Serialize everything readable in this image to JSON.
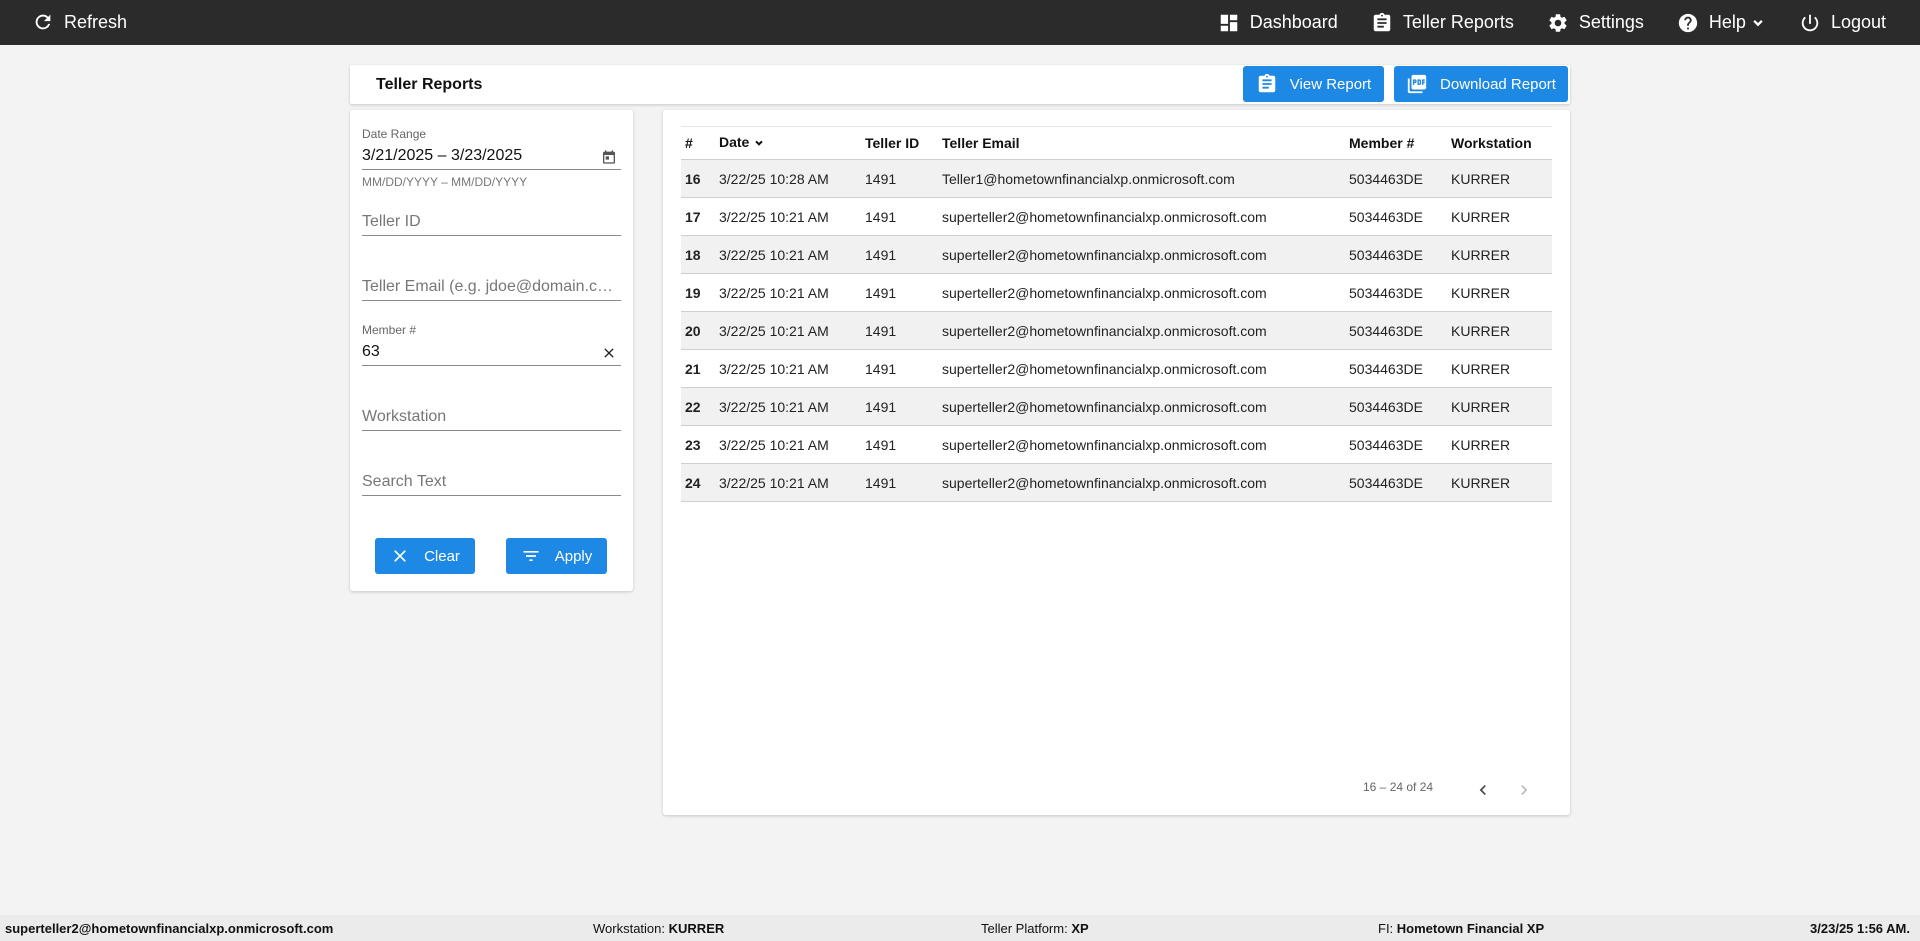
{
  "topbar": {
    "refresh_label": "Refresh",
    "nav": [
      {
        "label": "Dashboard",
        "icon": "dashboard-icon"
      },
      {
        "label": "Teller Reports",
        "icon": "clipboard-icon"
      },
      {
        "label": "Settings",
        "icon": "gear-icon"
      },
      {
        "label": "Help",
        "icon": "help-icon"
      },
      {
        "label": "Logout",
        "icon": "power-icon"
      }
    ]
  },
  "header": {
    "title": "Teller Reports",
    "view_report_label": "View Report",
    "download_report_label": "Download Report"
  },
  "filters": {
    "date_range_label": "Date Range",
    "date_range_value": "3/21/2025 – 3/23/2025",
    "date_range_hint": "MM/DD/YYYY – MM/DD/YYYY",
    "teller_id_placeholder": "Teller ID",
    "teller_email_placeholder": "Teller Email (e.g. jdoe@domain.c…",
    "member_label": "Member #",
    "member_value": "63",
    "workstation_placeholder": "Workstation",
    "search_text_placeholder": "Search Text",
    "clear_label": "Clear",
    "apply_label": "Apply"
  },
  "table": {
    "columns": [
      "#",
      "Date",
      "Teller ID",
      "Teller Email",
      "Member #",
      "Workstation"
    ],
    "rows": [
      [
        "16",
        "3/22/25 10:28 AM",
        "1491",
        "Teller1@hometownfinancialxp.onmicrosoft.com",
        "5034463DE",
        "KURRER"
      ],
      [
        "17",
        "3/22/25 10:21 AM",
        "1491",
        "superteller2@hometownfinancialxp.onmicrosoft.com",
        "5034463DE",
        "KURRER"
      ],
      [
        "18",
        "3/22/25 10:21 AM",
        "1491",
        "superteller2@hometownfinancialxp.onmicrosoft.com",
        "5034463DE",
        "KURRER"
      ],
      [
        "19",
        "3/22/25 10:21 AM",
        "1491",
        "superteller2@hometownfinancialxp.onmicrosoft.com",
        "5034463DE",
        "KURRER"
      ],
      [
        "20",
        "3/22/25 10:21 AM",
        "1491",
        "superteller2@hometownfinancialxp.onmicrosoft.com",
        "5034463DE",
        "KURRER"
      ],
      [
        "21",
        "3/22/25 10:21 AM",
        "1491",
        "superteller2@hometownfinancialxp.onmicrosoft.com",
        "5034463DE",
        "KURRER"
      ],
      [
        "22",
        "3/22/25 10:21 AM",
        "1491",
        "superteller2@hometownfinancialxp.onmicrosoft.com",
        "5034463DE",
        "KURRER"
      ],
      [
        "23",
        "3/22/25 10:21 AM",
        "1491",
        "superteller2@hometownfinancialxp.onmicrosoft.com",
        "5034463DE",
        "KURRER"
      ],
      [
        "24",
        "3/22/25 10:21 AM",
        "1491",
        "superteller2@hometownfinancialxp.onmicrosoft.com",
        "5034463DE",
        "KURRER"
      ]
    ],
    "pager_text": "16 – 24 of 24"
  },
  "footer": {
    "user_email": "superteller2@hometownfinancialxp.onmicrosoft.com",
    "workstation_label": "Workstation:",
    "workstation_value": "KURRER",
    "platform_label": "Teller Platform:",
    "platform_value": "XP",
    "fi_label": "FI:",
    "fi_value": "Hometown Financial XP",
    "datetime": "3/23/25 1:56 AM."
  },
  "colors": {
    "topbar_bg": "#2b2b2b",
    "accent": "#1e88e5",
    "page_bg": "#f3f3f3"
  }
}
